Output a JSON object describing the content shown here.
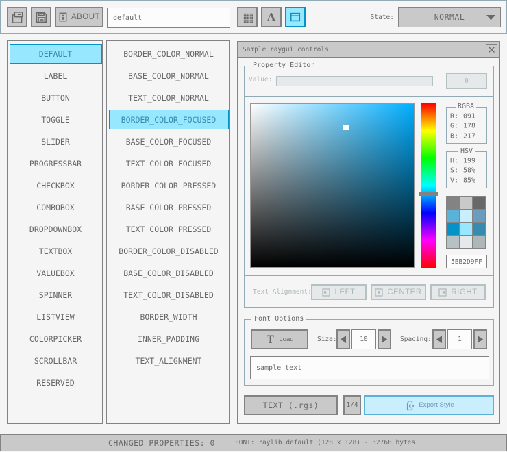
{
  "colors": {
    "background": "#f5f5f5",
    "panel_line": "#90abb5",
    "border_normal": "#838383",
    "base_normal": "#c9c9c9",
    "text_normal": "#686868",
    "border_focused": "#5bb2d9",
    "base_focused": "#c9effe",
    "text_focused": "#6c9bbc",
    "border_pressed": "#0492c7",
    "base_pressed": "#97e8ff",
    "text_pressed": "#368baf",
    "border_disabled": "#b5c1c2",
    "base_disabled": "#e6e9e9",
    "text_disabled": "#aeb7b8",
    "picker_hue_color": "#00aeff"
  },
  "toolbar": {
    "open_icon": "folder-open-icon",
    "save_icon": "floppy-disk-icon",
    "about_label": "ABOUT",
    "style_name_value": "default",
    "grid_icon": "grid-icon",
    "font_icon": "letter-a-icon",
    "window_icon": "window-icon",
    "state_label": "State:",
    "state_value": "NORMAL"
  },
  "controls_list": {
    "selected_index": 0,
    "items": [
      "DEFAULT",
      "LABEL",
      "BUTTON",
      "TOGGLE",
      "SLIDER",
      "PROGRESSBAR",
      "CHECKBOX",
      "COMBOBOX",
      "DROPDOWNBOX",
      "TEXTBOX",
      "VALUEBOX",
      "SPINNER",
      "LISTVIEW",
      "COLORPICKER",
      "SCROLLBAR",
      "RESERVED"
    ]
  },
  "properties_list": {
    "selected_index": 3,
    "items": [
      "BORDER_COLOR_NORMAL",
      "BASE_COLOR_NORMAL",
      "TEXT_COLOR_NORMAL",
      "BORDER_COLOR_FOCUSED",
      "BASE_COLOR_FOCUSED",
      "TEXT_COLOR_FOCUSED",
      "BORDER_COLOR_PRESSED",
      "BASE_COLOR_PRESSED",
      "TEXT_COLOR_PRESSED",
      "BORDER_COLOR_DISABLED",
      "BASE_COLOR_DISABLED",
      "TEXT_COLOR_DISABLED",
      "BORDER_WIDTH",
      "INNER_PADDING",
      "TEXT_ALIGNMENT"
    ]
  },
  "window": {
    "title": "Sample raygui controls",
    "property_editor": {
      "title": "Property Editor",
      "value_label": "Value:",
      "value_text": "",
      "zero_button_label": "0",
      "picker": {
        "hue": 199,
        "saturation_pct": 58,
        "value_pct": 85
      },
      "rgba": {
        "title": "RGBA",
        "rows": [
          {
            "label": "R:",
            "value": "091"
          },
          {
            "label": "G:",
            "value": "178"
          },
          {
            "label": "B:",
            "value": "217"
          }
        ]
      },
      "hsv": {
        "title": "HSV",
        "rows": [
          {
            "label": "H:",
            "value": "199"
          },
          {
            "label": "S:",
            "value": "58%"
          },
          {
            "label": "V:",
            "value": "85%"
          }
        ]
      },
      "swatches": [
        "#838383",
        "#c9c9c9",
        "#686868",
        "#5bb2d9",
        "#c9effe",
        "#6c9bbc",
        "#0492c7",
        "#97e8ff",
        "#368baf",
        "#b5c1c2",
        "#e6e9e9",
        "#aeb7b8"
      ],
      "hex_value": "5BB2D9FF",
      "text_alignment_label": "Text Alignment:",
      "alignment_buttons": {
        "left": "LEFT",
        "center": "CENTER",
        "right": "RIGHT"
      }
    },
    "font_options": {
      "title": "Font Options",
      "load_label": "Load",
      "load_icon_letter": "T",
      "size_label": "Size:",
      "size_value": "10",
      "spacing_label": "Spacing:",
      "spacing_value": "1",
      "sample_text": "sample text"
    },
    "export_bar": {
      "format_button": "TEXT (.rgs)",
      "pager_button": "1/4",
      "export_button": "Export Style"
    }
  },
  "statusbar": {
    "changed_properties": "CHANGED PROPERTIES: 0",
    "font_info": "FONT: raylib default (128 x 128) - 32768 bytes"
  }
}
